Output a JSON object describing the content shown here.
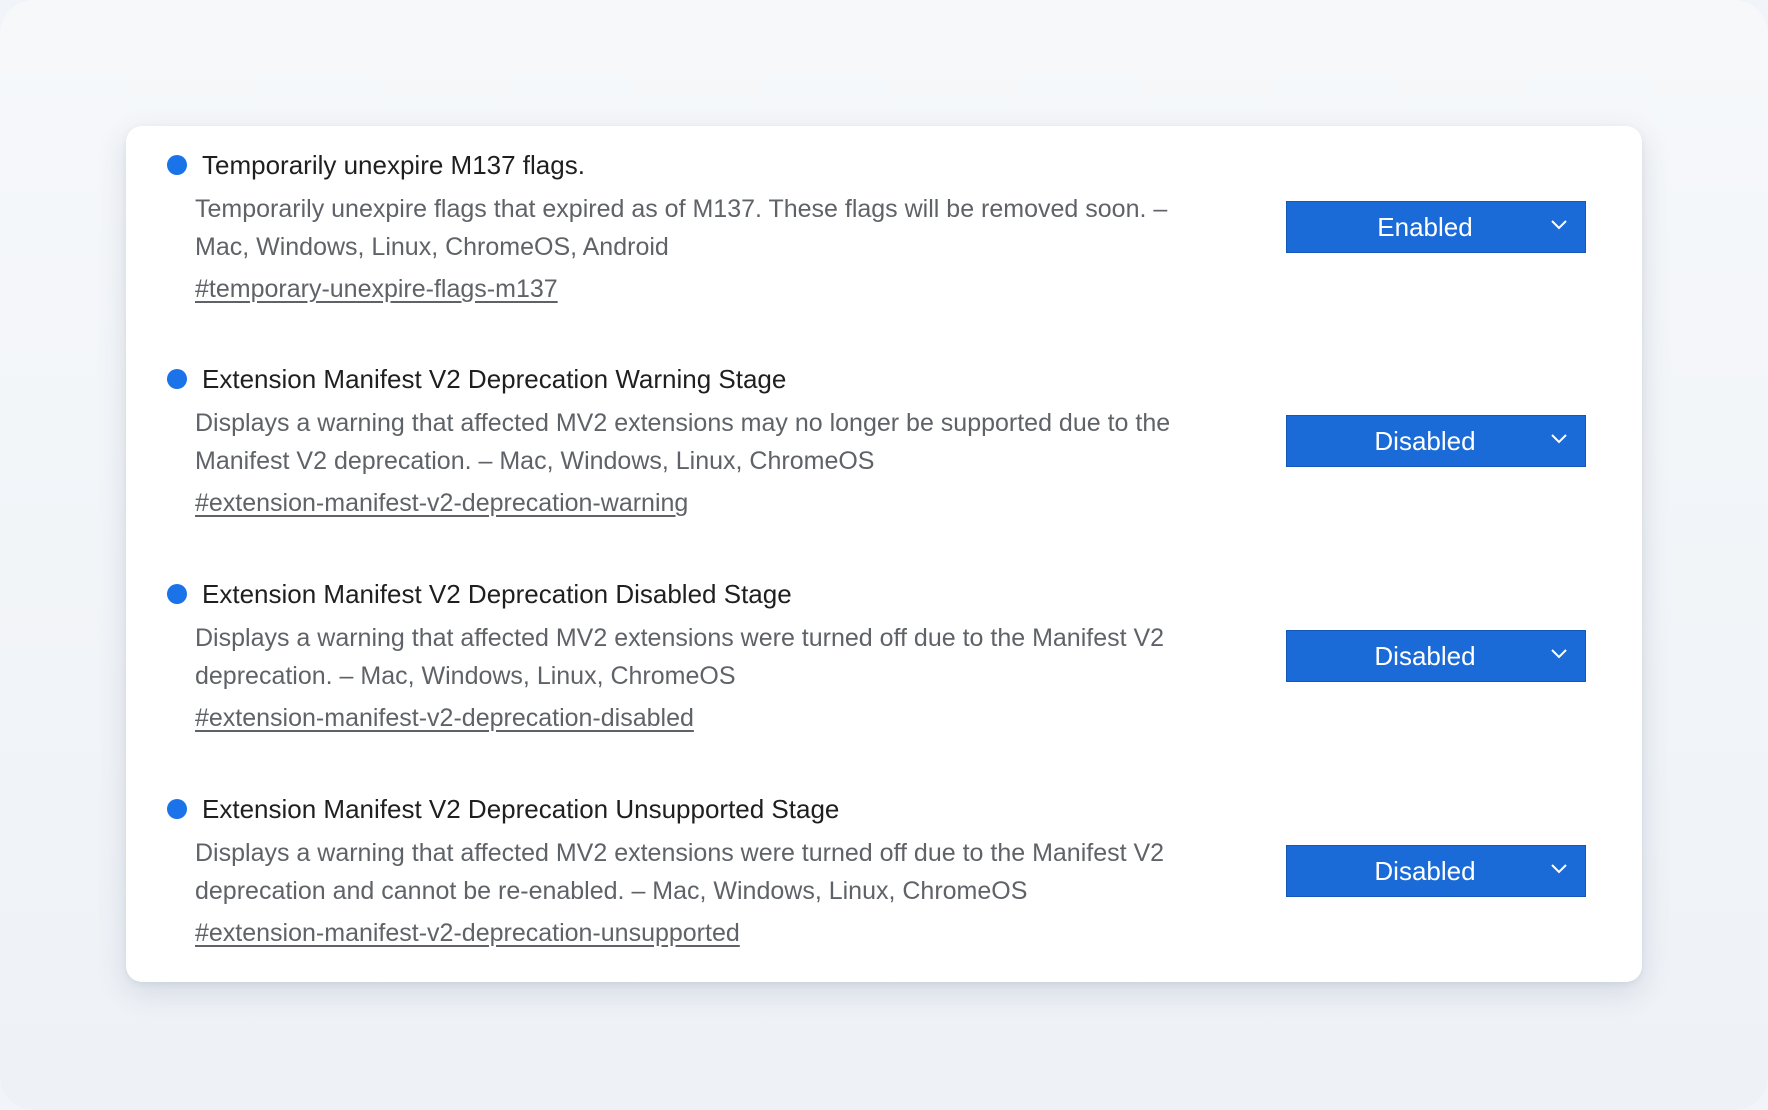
{
  "flags": [
    {
      "title": "Temporarily unexpire M137 flags.",
      "description": "Temporarily unexpire flags that expired as of M137. These flags will be removed soon. – Mac, Windows, Linux, ChromeOS, Android",
      "link": "#temporary-unexpire-flags-m137",
      "value": "Enabled"
    },
    {
      "title": "Extension Manifest V2 Deprecation Warning Stage",
      "description": "Displays a warning that affected MV2 extensions may no longer be supported due to the Manifest V2 deprecation. – Mac, Windows, Linux, ChromeOS",
      "link": "#extension-manifest-v2-deprecation-warning",
      "value": "Disabled"
    },
    {
      "title": "Extension Manifest V2 Deprecation Disabled Stage",
      "description": "Displays a warning that affected MV2 extensions were turned off due to the Manifest V2 deprecation. – Mac, Windows, Linux, ChromeOS",
      "link": "#extension-manifest-v2-deprecation-disabled",
      "value": "Disabled"
    },
    {
      "title": "Extension Manifest V2 Deprecation Unsupported Stage",
      "description": "Displays a warning that affected MV2 extensions were turned off due to the Manifest V2 deprecation and cannot be re-enabled. – Mac, Windows, Linux, ChromeOS",
      "link": "#extension-manifest-v2-deprecation-unsupported",
      "value": "Disabled"
    }
  ],
  "icons": {
    "status": "blue-dot-icon",
    "dropdown": "chevron-down-icon"
  },
  "colors": {
    "accent": "#1a73e8",
    "select_bg": "#1a6ad8"
  }
}
